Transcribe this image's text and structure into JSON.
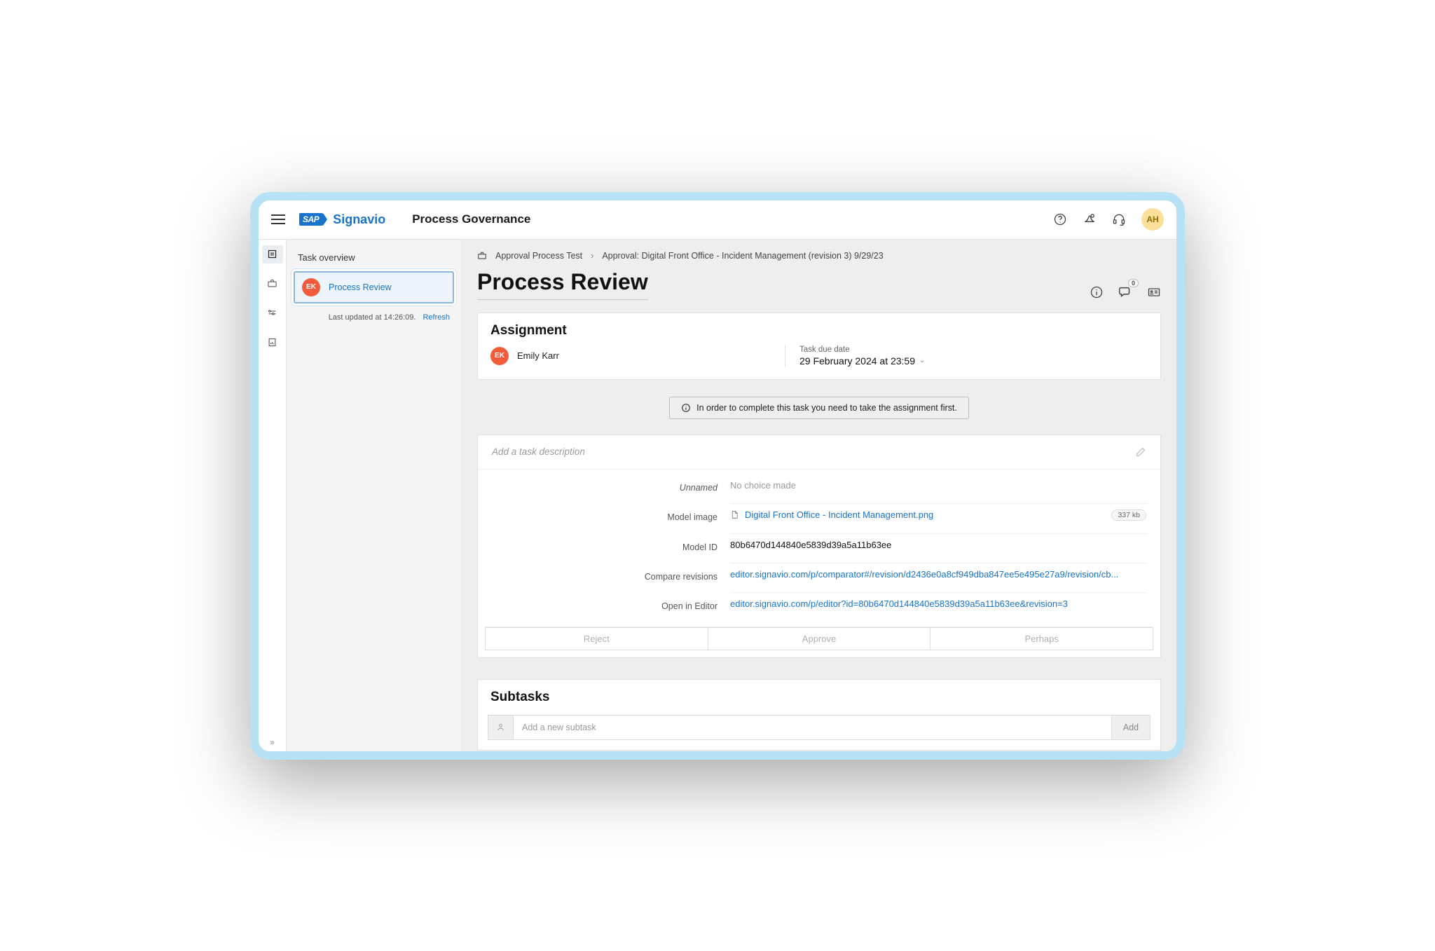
{
  "header": {
    "logo_text_1": "SAP",
    "logo_text_2": "Signavio",
    "app_title": "Process Governance",
    "avatar": "AH"
  },
  "sidebar": {
    "title": "Task overview",
    "task": {
      "avatar": "EK",
      "name": "Process Review"
    },
    "updated_label": "Last updated at 14:26:09.",
    "refresh": "Refresh"
  },
  "breadcrumb": {
    "item1": "Approval Process Test",
    "item2": "Approval: Digital Front Office - Incident Management (revision 3) 9/29/23"
  },
  "page_title": "Process Review",
  "comment_count": "0",
  "assignment": {
    "heading": "Assignment",
    "avatar": "EK",
    "name": "Emily Karr",
    "due_label": "Task due date",
    "due_value": "29 February 2024 at 23:59"
  },
  "info_banner": "In order to complete this task you need to take the assignment first.",
  "description_placeholder": "Add a task description",
  "fields": {
    "unnamed_label": "Unnamed",
    "unnamed_value": "No choice made",
    "model_image_label": "Model image",
    "model_image_value": "Digital Front Office - Incident Management.png",
    "model_image_size": "337 kb",
    "model_id_label": "Model ID",
    "model_id_value": "80b6470d144840e5839d39a5a11b63ee",
    "compare_label": "Compare revisions",
    "compare_value": "editor.signavio.com/p/comparator#/revision/d2436e0a8cf949dba847ee5e495e27a9/revision/cb...",
    "open_label": "Open in Editor",
    "open_value": "editor.signavio.com/p/editor?id=80b6470d144840e5839d39a5a11b63ee&revision=3"
  },
  "choice_buttons": {
    "reject": "Reject",
    "approve": "Approve",
    "perhaps": "Perhaps"
  },
  "subtasks": {
    "heading": "Subtasks",
    "placeholder": "Add a new subtask",
    "add_button": "Add"
  }
}
